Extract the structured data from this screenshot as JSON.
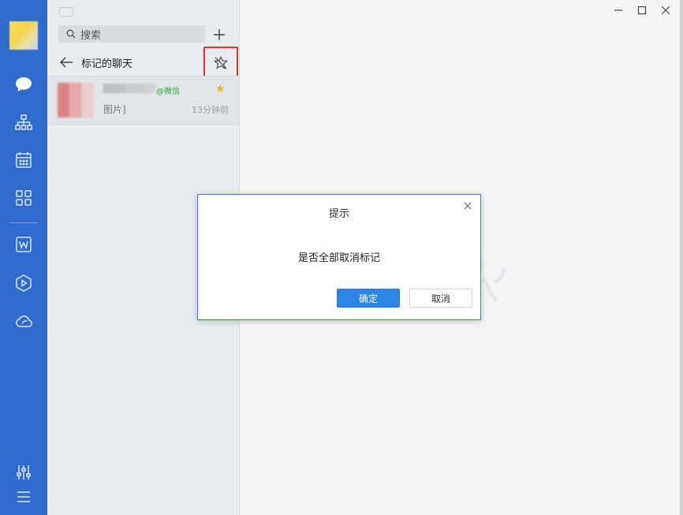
{
  "colors": {
    "rail": "#2f6bcd",
    "accent": "#2f84ea",
    "highlight_box": "#e8322e",
    "star": "#f2b01e",
    "wechat_tag": "#25a53a"
  },
  "rail": {
    "icons": [
      "chat-bubble-icon",
      "org-chart-icon",
      "calendar-icon",
      "apps-grid-icon",
      "word-doc-icon",
      "play-hexagon-icon",
      "cloud-icon",
      "settings-sliders-icon",
      "menu-icon"
    ]
  },
  "search": {
    "label": "搜索"
  },
  "list_header": {
    "title": "标记的聊天"
  },
  "chat_list": [
    {
      "tag": "@微信",
      "preview": "图片]",
      "time": "13分钟前",
      "starred": true
    }
  ],
  "dialog": {
    "title": "提示",
    "message": "是否全部取消标记",
    "ok_label": "确定",
    "cancel_label": "取消"
  }
}
